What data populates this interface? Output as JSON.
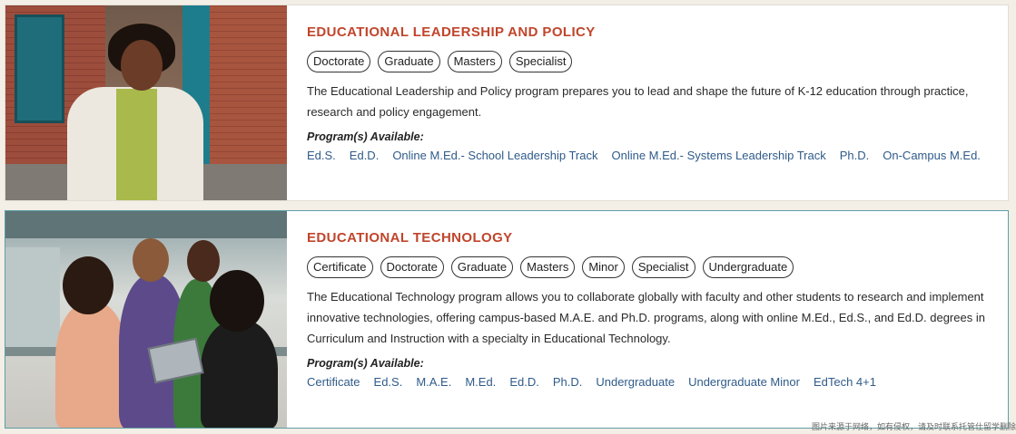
{
  "programs": [
    {
      "title": "EDUCATIONAL LEADERSHIP AND POLICY",
      "tags": [
        "Doctorate",
        "Graduate",
        "Masters",
        "Specialist"
      ],
      "description": "The Educational Leadership and Policy program prepares you to lead and shape the future of K-12 education through practice, research and policy engagement.",
      "available_label": "Program(s) Available:",
      "links": [
        "Ed.S.",
        "Ed.D.",
        "Online M.Ed.- School Leadership Track",
        "Online M.Ed.- Systems Leadership Track",
        "Ph.D.",
        "On-Campus M.Ed."
      ]
    },
    {
      "title": "EDUCATIONAL TECHNOLOGY",
      "tags": [
        "Certificate",
        "Doctorate",
        "Graduate",
        "Masters",
        "Minor",
        "Specialist",
        "Undergraduate"
      ],
      "description": "The Educational Technology program allows you to collaborate globally with faculty and other students to research and implement innovative technologies, offering campus-based M.A.E. and Ph.D. programs, along with online M.Ed., Ed.S., and Ed.D. degrees in Curriculum and Instruction with a specialty in Educational Technology.",
      "available_label": "Program(s) Available:",
      "links": [
        "Certificate",
        "Ed.S.",
        "M.A.E.",
        "M.Ed.",
        "Ed.D.",
        "Ph.D.",
        "Undergraduate",
        "Undergraduate Minor",
        "EdTech 4+1"
      ]
    }
  ],
  "watermark": "图片来源于网络，如有侵权，请及时联系托管仕留学删除",
  "colors": {
    "title": "#c0452b",
    "link": "#2f5b8a",
    "active_border": "#5f9fa6"
  }
}
